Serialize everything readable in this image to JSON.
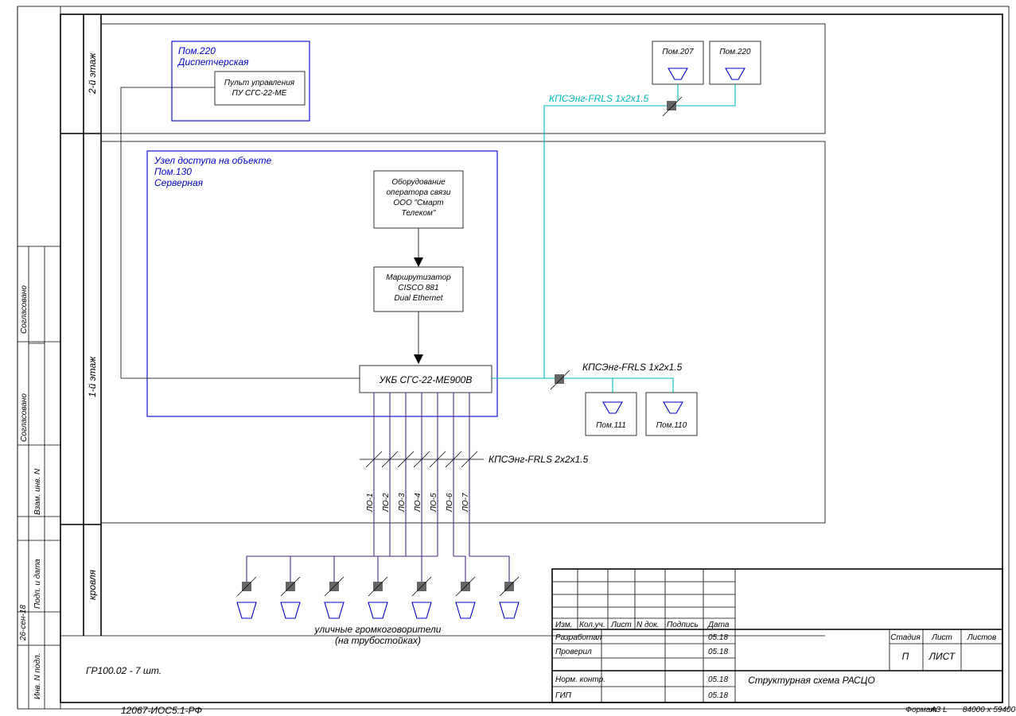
{
  "frame": {
    "sidebar": {
      "labels": [
        "Согласовано",
        "Согласовано",
        "Взам. инв. N",
        "Подп. и дата",
        "Инв. N подл."
      ],
      "date_small": "26-сен-18"
    },
    "footer": {
      "format_label": "Формат",
      "format_value": "A3 L",
      "dims": "84000 x 59400"
    },
    "doc_no": "12067-ИОС5.1-РФ"
  },
  "floors": {
    "f2": "2-й этаж",
    "f1": "1-й этаж",
    "roof": "кровля"
  },
  "zones": {
    "dispatch": {
      "title1": "Пом.220",
      "title2": "Диспетчерская",
      "box": {
        "l1": "Пульт управления",
        "l2": "ПУ СГС-22-МЕ"
      }
    },
    "access": {
      "title1": "Узел доступа на объекте",
      "title2": "Пом.130",
      "title3": "Серверная",
      "operator": {
        "l1": "Оборудование",
        "l2": "оператора связи",
        "l3": "ООО \"Смарт",
        "l4": "Телеком\""
      },
      "router": {
        "l1": "Маршрутизатор",
        "l2": "CISCO 881",
        "l3": "Dual Ethernet"
      },
      "ukb": "УКБ СГС-22-МЕ900В"
    }
  },
  "speakers_top": [
    {
      "label": "Пом.207"
    },
    {
      "label": "Пом.220"
    }
  ],
  "speakers_mid": [
    {
      "label": "Пом.111"
    },
    {
      "label": "Пом.110"
    }
  ],
  "cables": {
    "top": "КПСЭнг-FRLS 1x2x1.5",
    "mid": "КПСЭнг-FRLS 1x2x1.5",
    "bottom": "КПСЭнг-FRLS 2x2x1.5"
  },
  "lines_out": [
    "ЛО-1",
    "ЛО-2",
    "ЛО-3",
    "ЛО-4",
    "ЛО-5",
    "ЛО-6",
    "ЛО-7"
  ],
  "loudspeakers_note": {
    "l1": "уличные громкоговорители",
    "l2": "(на трубостойках)"
  },
  "note_left": "ГР100.02 - 7 шт.",
  "titleblock": {
    "cols": [
      "Изм.",
      "Кол.уч.",
      "Лист",
      "N док.",
      "Подпись",
      "Дата"
    ],
    "rows": [
      {
        "role": "Разработал",
        "date": "05.18"
      },
      {
        "role": "Проверил",
        "date": "05.18"
      },
      {
        "role": "",
        "date": ""
      },
      {
        "role": "Норм. контр.",
        "date": "05.18"
      },
      {
        "role": "ГИП",
        "date": "05.18"
      }
    ],
    "title_right": "Структурная схема  РАСЦО",
    "stage_h": "Стадия",
    "sheet_h": "Лист",
    "sheets_h": "Листов",
    "stage_v": "П",
    "sheet_v": "ЛИСТ"
  }
}
